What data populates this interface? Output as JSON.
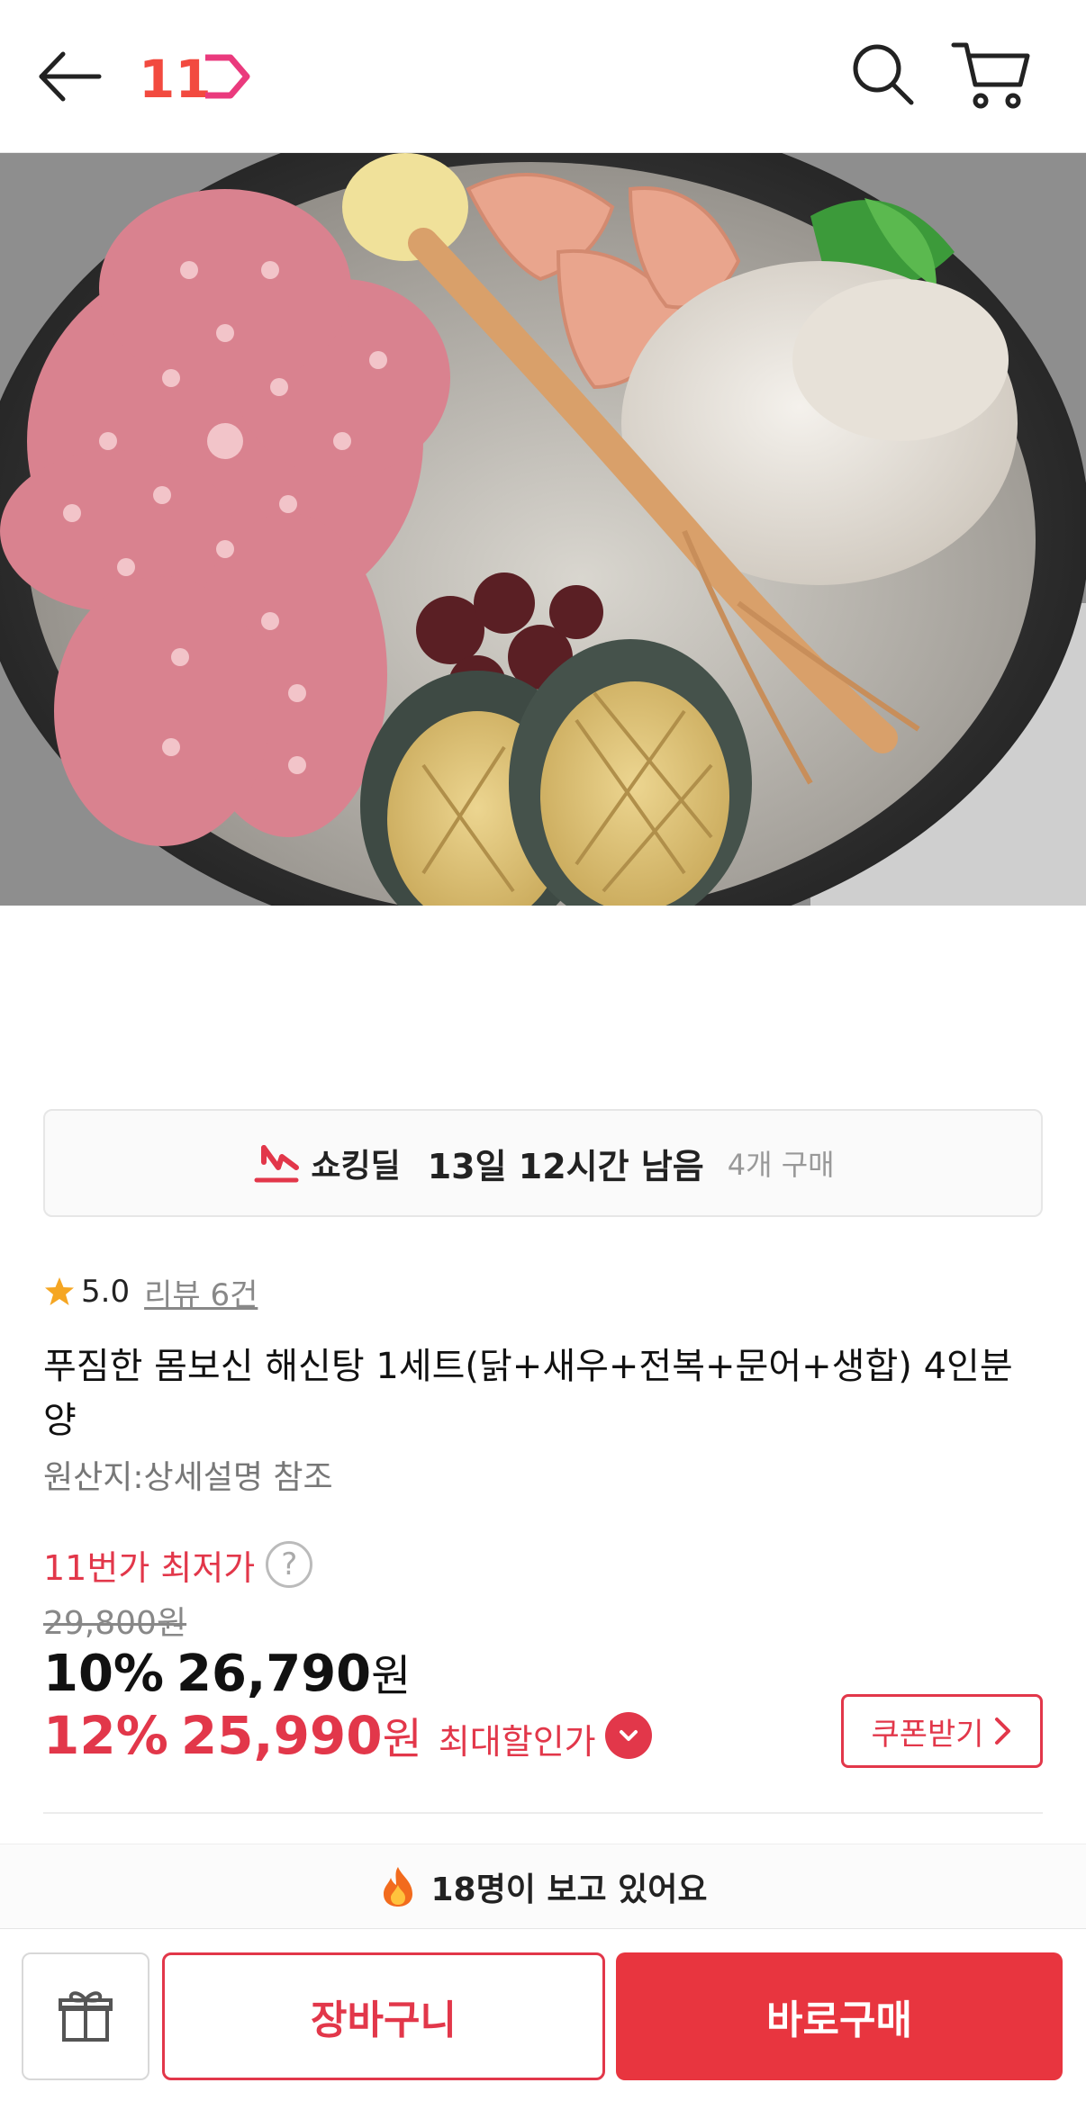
{
  "header": {
    "back_icon": "arrow-left-icon",
    "logo_text": "11",
    "search_icon": "search-icon",
    "cart_icon": "cart-icon"
  },
  "deal": {
    "name": "쇼킹딜",
    "time_left": "13일 12시간 남음",
    "purchases": "4개 구매",
    "icon": "shocking-deal-icon"
  },
  "rating": {
    "score": "5.0",
    "review_link": "리뷰 6건"
  },
  "product": {
    "title": "푸짐한 몸보신 해신탕 1세트(닭+새우+전복+문어+생합) 4인분양",
    "origin": "원산지:상세설명 참조"
  },
  "price": {
    "lowest_label": "11번가 최저가",
    "help_glyph": "?",
    "original": "29,800원",
    "discount1_pct": "10%",
    "discount1_amount": "26,790",
    "currency": "원",
    "discount2_pct": "12%",
    "discount2_amount": "25,990",
    "max_label": "최대할인가",
    "coupon_label": "쿠폰받기"
  },
  "viewing": {
    "text": "18명이 보고 있어요"
  },
  "bottom_bar": {
    "gift_icon": "gift-icon",
    "cart_label": "장바구니",
    "buy_label": "바로구매"
  },
  "colors": {
    "accent": "#e2374a",
    "buy_button": "#e8353f",
    "star": "#f5a623"
  }
}
